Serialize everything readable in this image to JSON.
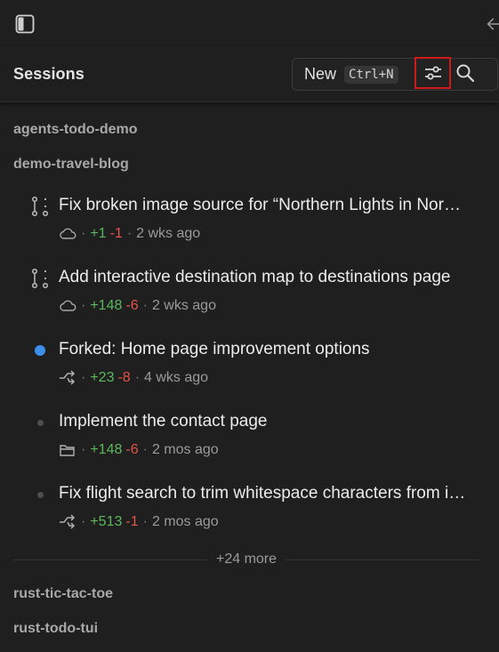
{
  "header": {
    "title": "Sessions",
    "new_label": "New",
    "new_shortcut": "Ctrl+N"
  },
  "icons": {
    "sidebar_toggle": "sidebar-toggle-icon",
    "back": "arrow-left-icon",
    "filter": "sliders-icon",
    "search": "search-icon"
  },
  "colors": {
    "accent_blue": "#3b8eea",
    "added_green": "#5cb85c",
    "removed_red": "#e5534b",
    "highlight_border": "#d01a1a"
  },
  "groups": {
    "g1": "agents-todo-demo",
    "g2": "demo-travel-blog",
    "g3": "rust-tic-tac-toe",
    "g4": "rust-todo-tui"
  },
  "sessions": [
    {
      "title": "Fix broken image source for “Northern Lights in Norway” post",
      "status_icon": "pull-request-icon",
      "env_icon": "cloud-icon",
      "added": "+1",
      "removed": "-1",
      "time": "2 wks ago"
    },
    {
      "title": "Add interactive destination map to destinations page",
      "status_icon": "pull-request-icon",
      "env_icon": "cloud-icon",
      "added": "+148",
      "removed": "-6",
      "time": "2 wks ago"
    },
    {
      "title": "Forked: Home page improvement options",
      "status_icon": "unread-dot",
      "env_icon": "branch-icon",
      "added": "+23",
      "removed": "-8",
      "time": "4 wks ago"
    },
    {
      "title": "Implement the contact page",
      "status_icon": "idle-dot",
      "env_icon": "folder-icon",
      "added": "+148",
      "removed": "-6",
      "time": "2 mos ago"
    },
    {
      "title": "Fix flight search to trim whitespace characters from input",
      "status_icon": "idle-dot",
      "env_icon": "branch-icon",
      "added": "+513",
      "removed": "-1",
      "time": "2 mos ago"
    }
  ],
  "more_label": "+24 more"
}
